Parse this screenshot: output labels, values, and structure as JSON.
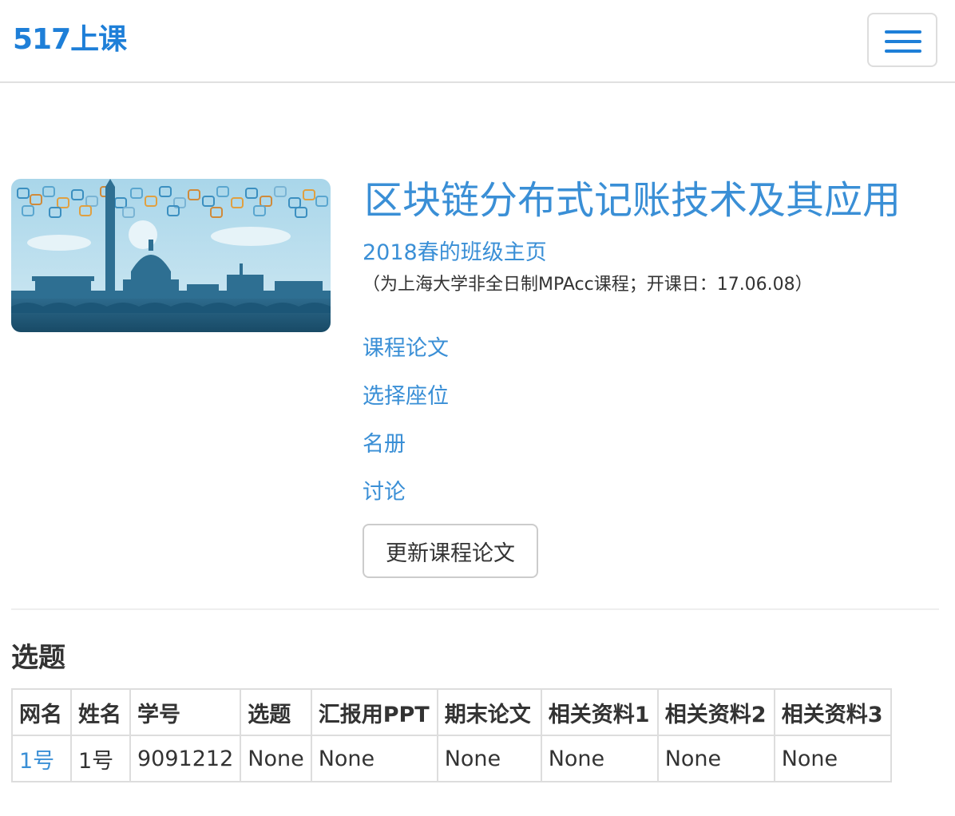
{
  "navbar": {
    "brand": "517上课",
    "menu_icon": "hamburger-menu-icon"
  },
  "course": {
    "cover_image": "city-skyline-blockchain-image",
    "title": "区块链分布式记账技术及其应用",
    "semester_link": "2018春的班级主页",
    "note": "（为上海大学非全日制MPAcc课程；开课日：17.06.08）",
    "links": [
      "课程论文",
      "选择座位",
      "名册",
      "讨论"
    ],
    "update_button": "更新课程论文"
  },
  "topics": {
    "heading": "选题",
    "columns": [
      "网名",
      "姓名",
      "学号",
      "选题",
      "汇报用PPT",
      "期末论文",
      "相关资料1",
      "相关资料2",
      "相关资料3"
    ],
    "rows": [
      [
        "1号",
        "1号",
        "9091212",
        "None",
        "None",
        "None",
        "None",
        "None",
        "None"
      ]
    ]
  },
  "colors": {
    "brand": "#1e7fd8",
    "link": "#3a8fd6",
    "text": "#333333",
    "border": "#dddddd"
  }
}
